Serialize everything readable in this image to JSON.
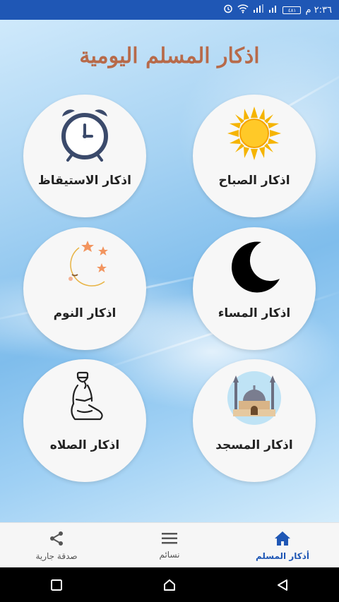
{
  "status_bar": {
    "time": "٢:٣٦ م",
    "battery_text": "٤٨١"
  },
  "app": {
    "title": "اذكار المسلم اليومية"
  },
  "tiles": [
    {
      "label": "اذكار الصباح",
      "icon": "sun-icon"
    },
    {
      "label": "اذكار الاستيقاظ",
      "icon": "alarm-clock-icon"
    },
    {
      "label": "اذكار المساء",
      "icon": "crescent-moon-icon"
    },
    {
      "label": "اذكار النوم",
      "icon": "moon-stars-icon"
    },
    {
      "label": "اذكار المسجد",
      "icon": "mosque-icon"
    },
    {
      "label": "اذكار الصلاه",
      "icon": "praying-man-icon"
    }
  ],
  "bottom_nav": {
    "items": [
      {
        "label": "صدقة جارية",
        "icon": "share-icon"
      },
      {
        "label": "نسائم",
        "icon": "menu-icon"
      },
      {
        "label": "أذكار المسلم",
        "icon": "home-icon",
        "active": true
      }
    ]
  },
  "colors": {
    "status_bar": "#1f57b5",
    "title": "#b76a4a",
    "nav_active": "#1f57b5"
  }
}
